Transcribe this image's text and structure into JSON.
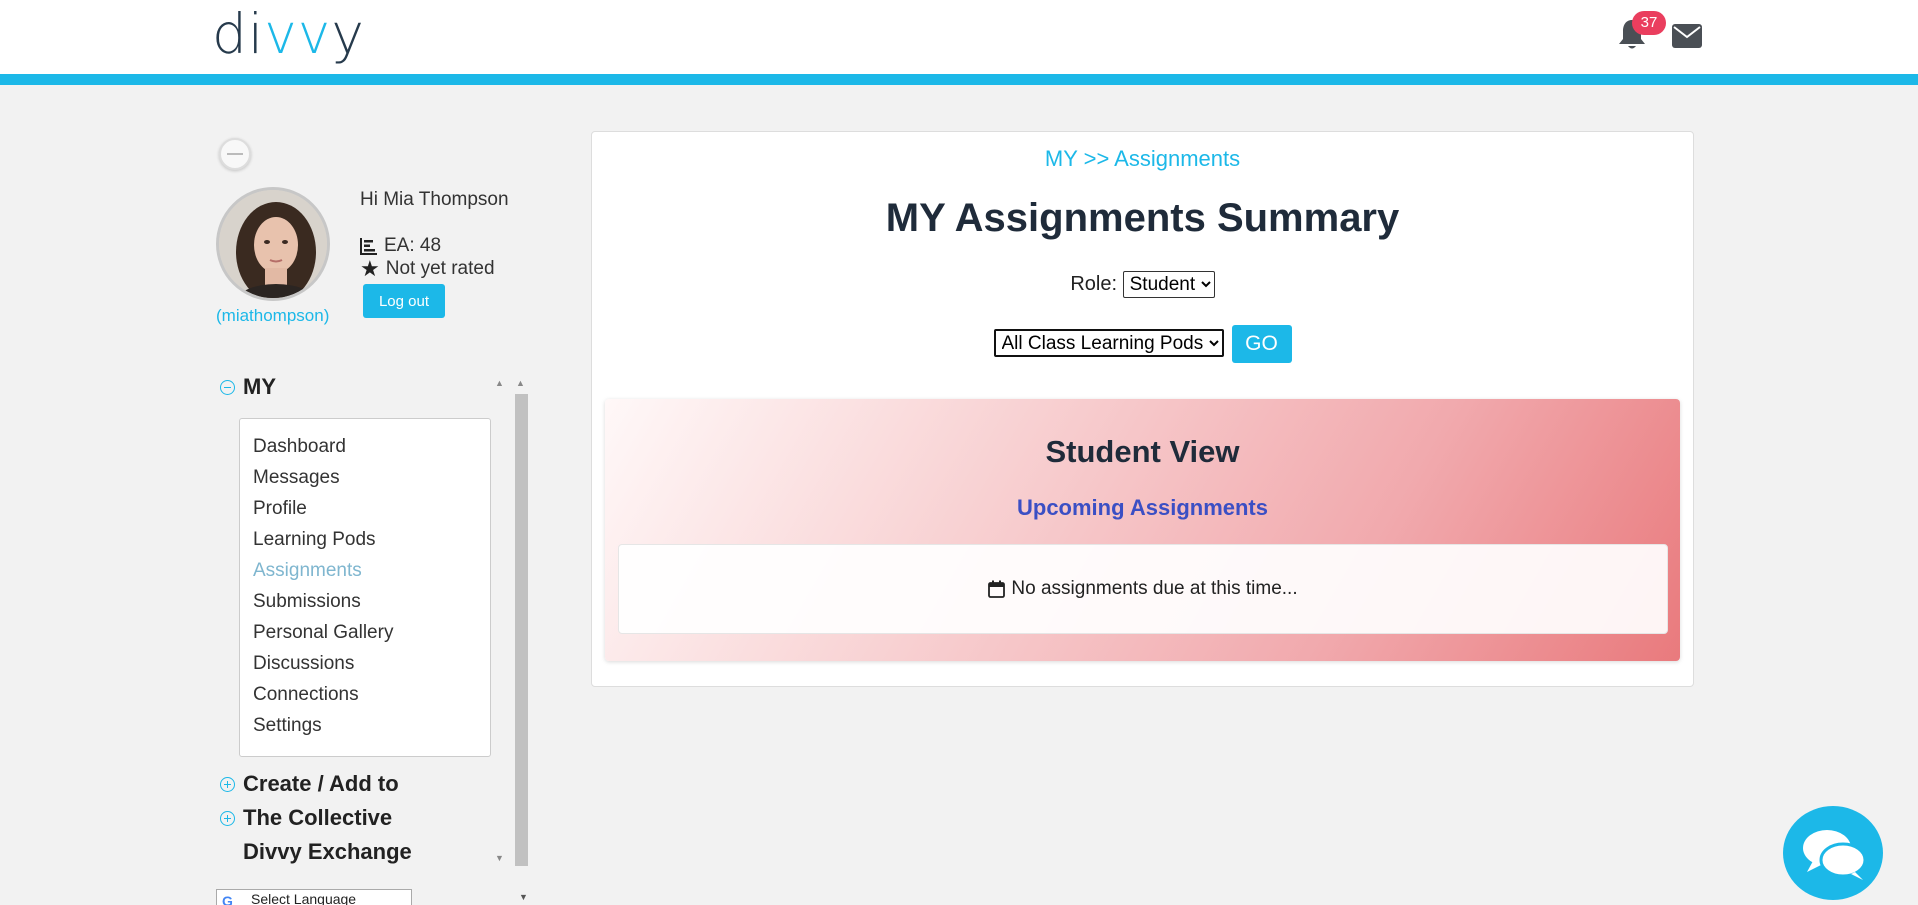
{
  "header": {
    "logo_text_1": "di",
    "logo_text_2": "vv",
    "logo_text_3": "y",
    "notification_count": "37",
    "accent_color": "#1cb8e8"
  },
  "profile": {
    "greeting": "Hi Mia Thompson",
    "username": "(miathompson)",
    "ea": "EA: 48",
    "rating": "Not yet rated",
    "logout_label": "Log out"
  },
  "sidebar": {
    "sections": [
      {
        "label": "MY",
        "icon": "minus-circle-icon"
      },
      {
        "label": "Create / Add to",
        "icon": "plus-circle-icon"
      },
      {
        "label": "The Collective",
        "icon": "plus-circle-icon"
      },
      {
        "label": "Divvy Exchange",
        "icon": ""
      }
    ],
    "items": [
      {
        "label": "Dashboard"
      },
      {
        "label": "Messages"
      },
      {
        "label": "Profile"
      },
      {
        "label": "Learning Pods"
      },
      {
        "label": "Assignments"
      },
      {
        "label": "Submissions"
      },
      {
        "label": "Personal Gallery"
      },
      {
        "label": "Discussions"
      },
      {
        "label": "Connections"
      },
      {
        "label": "Settings"
      }
    ],
    "active_item": "Assignments",
    "language_select": "Select Language"
  },
  "main": {
    "breadcrumb": "MY >> Assignments",
    "title": "MY Assignments Summary",
    "role_label": "Role:",
    "role_value": "Student",
    "pods_value": "All Class Learning Pods",
    "go_label": "GO",
    "student_view_title": "Student View",
    "upcoming_title": "Upcoming Assignments",
    "empty_message": "No assignments due at this time..."
  }
}
